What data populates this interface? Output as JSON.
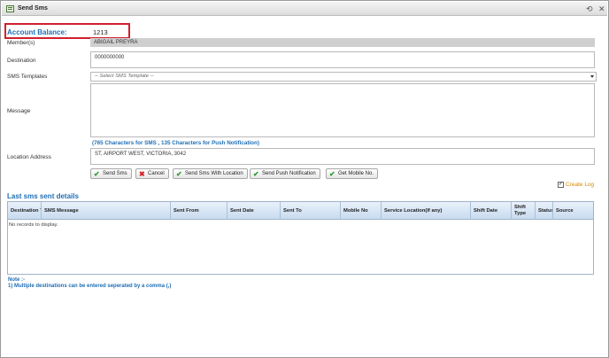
{
  "window": {
    "title": "Send Sms",
    "settings_glyph": "⟲",
    "close_glyph": "✕"
  },
  "account": {
    "label": "Account Balance:",
    "value": "1213"
  },
  "form": {
    "members_label": "Member(s)",
    "members_value": "ABIGAIL PREYRA",
    "destination_label": "Destination",
    "destination_value": "0000000000",
    "templates_label": "SMS Templates",
    "template_placeholder": "-- Select SMS Template --",
    "message_label": "Message",
    "message_value": "",
    "chars_info": "(765 Characters for SMS , 135 Characters for Push Notification)",
    "location_label": "Location Address",
    "location_value": "ST, AIRPORT WEST, VICTORIA, 3042"
  },
  "buttons": {
    "send_sms": "Send Sms",
    "cancel": "Cancel",
    "send_with_location": "Send Sms With Location",
    "send_push": "Send Push Notification",
    "get_mobile": "Get Mobile No."
  },
  "create_log": {
    "label": "Create Log",
    "checked": true
  },
  "history": {
    "title": "Last sms sent details",
    "columns": [
      "Destination Ty",
      "SMS Message",
      "Sent From",
      "Sent Date",
      "Sent To",
      "Mobile No",
      "Service Location(If any)",
      "Shift Date",
      "Shift Type",
      "Status",
      "Source"
    ],
    "empty_text": "No records to display."
  },
  "notes": {
    "heading": "Note :-",
    "line1": "1) Multiple destinations can be entered seperated by a comma (,)"
  },
  "colors": {
    "accent_blue": "#1f6eb5",
    "highlight_red": "#d0202f",
    "log_orange": "#d88a00"
  }
}
